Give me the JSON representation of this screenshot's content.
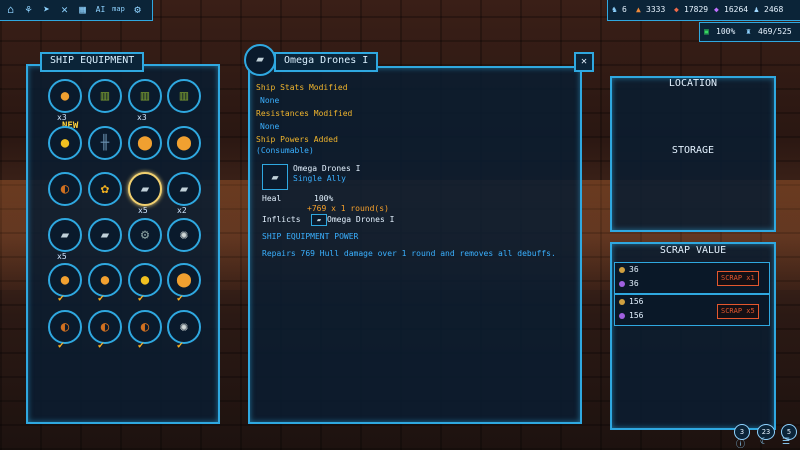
{
  "resources": {
    "r1": "6",
    "r2": "3333",
    "r3": "17829",
    "r4": "16264",
    "r5": "2468",
    "hull_pct": "100%",
    "capacity": "469/525"
  },
  "nav_icons": [
    "home-icon",
    "tree-icon",
    "ship-icon",
    "tools-icon",
    "grid-icon",
    "ai-icon",
    "map-icon",
    "settings-icon"
  ],
  "nav_labels": {
    "ai": "AI",
    "map": "map"
  },
  "equipment": {
    "title": "SHIP EQUIPMENT",
    "new_badge": "NEW",
    "counts": [
      "x3",
      "x3",
      "x5",
      "x2",
      "x5"
    ],
    "check_glyph": "✔"
  },
  "detail": {
    "title": "Omega Drones I",
    "stats_header": "Ship Stats Modified",
    "stats_value": "None",
    "res_header": "Resistances Modified",
    "res_value": "None",
    "powers_header": "Ship Powers Added",
    "powers_note": "(Consumable)",
    "power_name": "Omega Drones I",
    "power_target": "Single Ally",
    "heal_label": "Heal",
    "heal_value": "100%",
    "heal_detail": "+769 x 1 round(s)",
    "inflicts_label": "Inflicts",
    "inflicts_value": "Omega Drones I",
    "power_type": "SHIP EQUIPMENT POWER",
    "description": "Repairs 769 Hull damage over 1 round and removes all debuffs.",
    "close_glyph": "✕"
  },
  "location": {
    "title": "LOCATION",
    "value": "STORAGE"
  },
  "scrap": {
    "title": "SCRAP VALUE",
    "row1": {
      "a": "36",
      "b": "36",
      "button": "SCRAP x1"
    },
    "row2": {
      "a": "156",
      "b": "156",
      "button": "SCRAP x5"
    }
  },
  "bottom_badges": {
    "b1": "3",
    "b2": "23",
    "b3": "5"
  },
  "colors": {
    "accent": "#2fa8e0",
    "yellow": "#f1b52d",
    "blue_text": "#3ab0ff",
    "scrap_red": "#e4572e"
  }
}
